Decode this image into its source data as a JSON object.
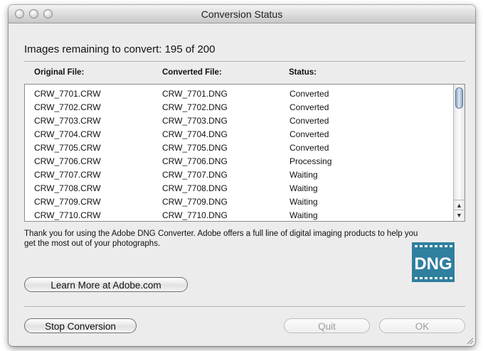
{
  "window": {
    "title": "Conversion Status"
  },
  "status": {
    "remaining_text": "Images remaining to convert: 195 of 200"
  },
  "columns": {
    "original": "Original File:",
    "converted": "Converted File:",
    "status": "Status:"
  },
  "rows": [
    {
      "original": "CRW_7701.CRW",
      "converted": "CRW_7701.DNG",
      "status": "Converted"
    },
    {
      "original": "CRW_7702.CRW",
      "converted": "CRW_7702.DNG",
      "status": "Converted"
    },
    {
      "original": "CRW_7703.CRW",
      "converted": "CRW_7703.DNG",
      "status": "Converted"
    },
    {
      "original": "CRW_7704.CRW",
      "converted": "CRW_7704.DNG",
      "status": "Converted"
    },
    {
      "original": "CRW_7705.CRW",
      "converted": "CRW_7705.DNG",
      "status": "Converted"
    },
    {
      "original": "CRW_7706.CRW",
      "converted": "CRW_7706.DNG",
      "status": "Processing"
    },
    {
      "original": "CRW_7707.CRW",
      "converted": "CRW_7707.DNG",
      "status": "Waiting"
    },
    {
      "original": "CRW_7708.CRW",
      "converted": "CRW_7708.DNG",
      "status": "Waiting"
    },
    {
      "original": "CRW_7709.CRW",
      "converted": "CRW_7709.DNG",
      "status": "Waiting"
    },
    {
      "original": "CRW_7710.CRW",
      "converted": "CRW_7710.DNG",
      "status": "Waiting"
    }
  ],
  "message": {
    "text": "Thank you for using the Adobe DNG Converter.  Adobe offers a full line of digital imaging products to help you get the most out of your photographs."
  },
  "logo": {
    "text": "DNG",
    "color": "#2f7f9f"
  },
  "buttons": {
    "learn_more": "Learn More at Adobe.com",
    "stop": "Stop Conversion",
    "quit": "Quit",
    "ok": "OK"
  }
}
